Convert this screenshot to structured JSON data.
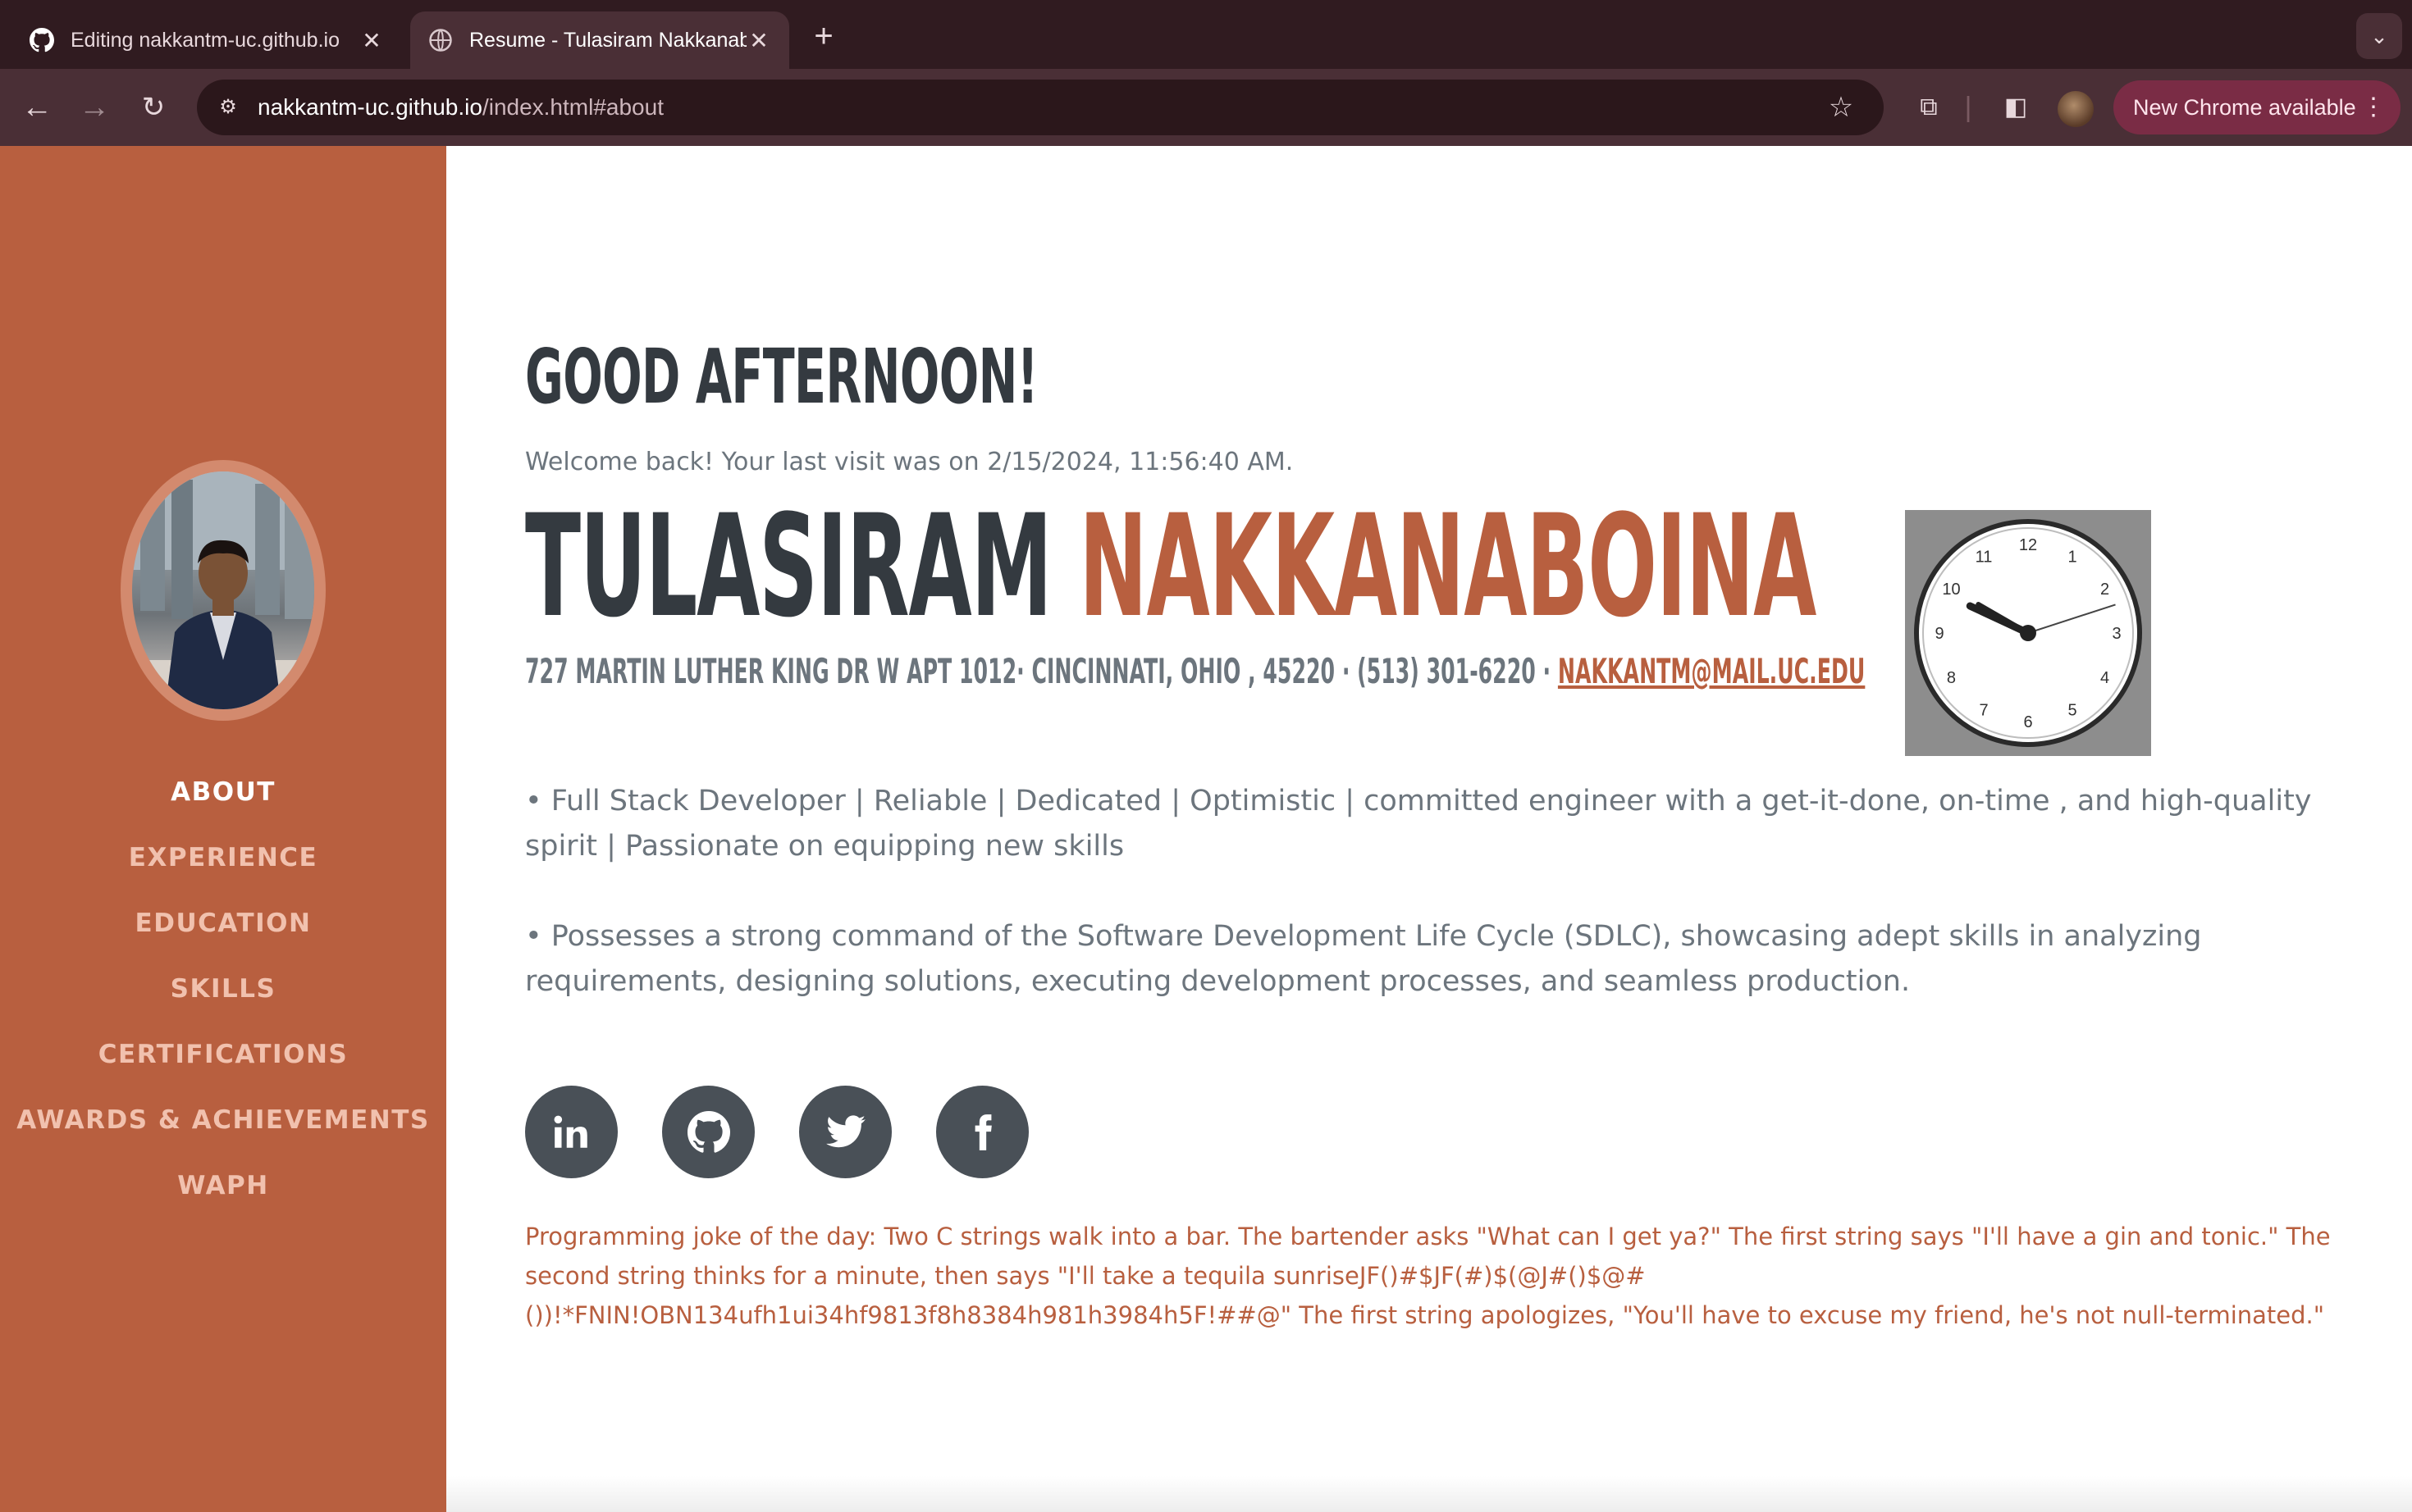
{
  "browser": {
    "tabs": [
      {
        "title": "Editing nakkantm-uc.github.io",
        "favicon": "github-icon",
        "active": false
      },
      {
        "title": "Resume - Tulasiram Nakkanaboina",
        "favicon": "globe-icon",
        "active": true
      }
    ],
    "url_host": "nakkantm-uc.github.io",
    "url_path": "/index.html#about",
    "update_button": "New Chrome available",
    "colors": {
      "frame": "#301b20",
      "toolbar": "#4a2f36",
      "update": "#7a2c45"
    }
  },
  "sidebar": {
    "profile_image": "profile-photo",
    "nav": [
      {
        "label": "ABOUT",
        "active": true
      },
      {
        "label": "EXPERIENCE",
        "active": false
      },
      {
        "label": "EDUCATION",
        "active": false
      },
      {
        "label": "SKILLS",
        "active": false
      },
      {
        "label": "CERTIFICATIONS",
        "active": false
      },
      {
        "label": "AWARDS & ACHIEVEMENTS",
        "active": false
      },
      {
        "label": "WAPH",
        "active": false
      }
    ],
    "colors": {
      "background": "#b85f3f",
      "active": "#ffffff",
      "inactive": "#f1c1ae"
    }
  },
  "about": {
    "greeting": "GOOD AFTERNOON!",
    "welcome": "Welcome back! Your last visit was on 2/15/2024, 11:56:40 AM.",
    "first_name": "TULASIRAM",
    "last_name": "NAKKANABOINA",
    "address": "727 MARTIN LUTHER KING DR W APT 1012· CINCINNATI, OHIO , 45220 · (513) 301-6220 · ",
    "email": "NAKKANTM@MAIL.UC.EDU",
    "clock": {
      "hour": 9,
      "minute": 50,
      "second": 12,
      "numerals": [
        "12",
        "1",
        "2",
        "3",
        "4",
        "5",
        "6",
        "7",
        "8",
        "9",
        "10",
        "11"
      ]
    },
    "bullets": [
      "• Full Stack Developer | Reliable | Dedicated | Optimistic | committed engineer with a get-it-done, on-time , and high-quality spirit | Passionate on equipping new skills",
      "• Possesses a strong command of the Software Development Life Cycle (SDLC), showcasing adept skills in analyzing requirements, designing solutions, executing development processes, and seamless production."
    ],
    "social": [
      "linkedin-icon",
      "github-icon",
      "twitter-icon",
      "facebook-icon"
    ],
    "joke": "Programming joke of the day: Two C strings walk into a bar. The bartender asks \"What can I get ya?\" The first string says \"I'll have a gin and tonic.\" The second string thinks for a minute, then says \"I'll take a tequila sunriseJF()#$JF(#)$(@J#()$@#())!*FNIN!OBN134ufh1ui34hf9813f8h8384h981h3984h5F!##@\" The first string apologizes, \"You'll have to excuse my friend, he's not null-terminated.\"",
    "colors": {
      "accent": "#b85f3f",
      "heading": "#343a40",
      "muted": "#6c757d"
    }
  }
}
